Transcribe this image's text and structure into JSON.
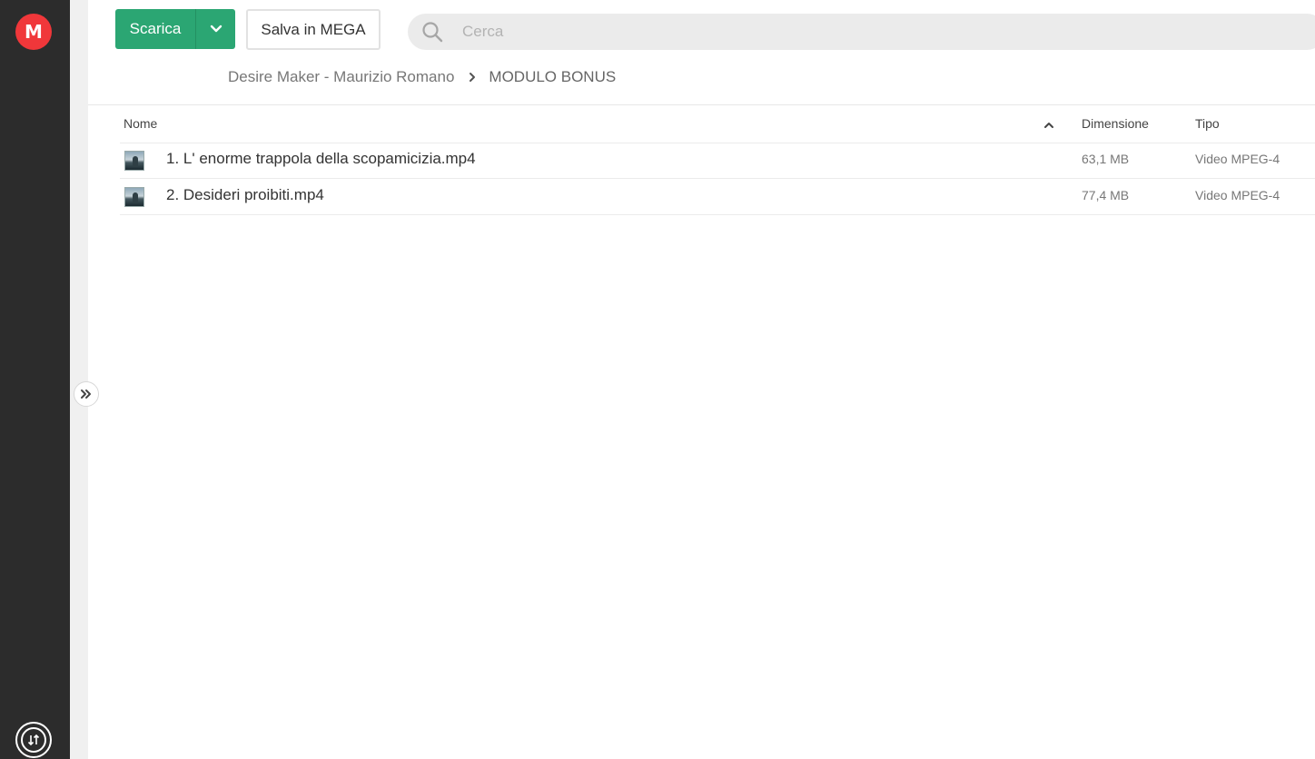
{
  "sidebar": {
    "logo_letter": "M",
    "logo_color": "#f0373a",
    "transfer_icon": "transfer-icon"
  },
  "toolbar": {
    "download_label": "Scarica",
    "download_color": "#2ba673",
    "save_label": "Salva in MEGA"
  },
  "search": {
    "placeholder": "Cerca",
    "value": ""
  },
  "breadcrumb": {
    "items": [
      "Desire Maker - Maurizio Romano",
      "MODULO BONUS"
    ]
  },
  "table": {
    "columns": {
      "name": "Nome",
      "size": "Dimensione",
      "type": "Tipo"
    },
    "sort": "ascending",
    "rows": [
      {
        "name": "1. L' enorme trappola della scopamicizia.mp4",
        "size": "63,1 MB",
        "type": "Video MPEG-4"
      },
      {
        "name": "2. Desideri proibiti.mp4",
        "size": "77,4 MB",
        "type": "Video MPEG-4"
      }
    ]
  }
}
